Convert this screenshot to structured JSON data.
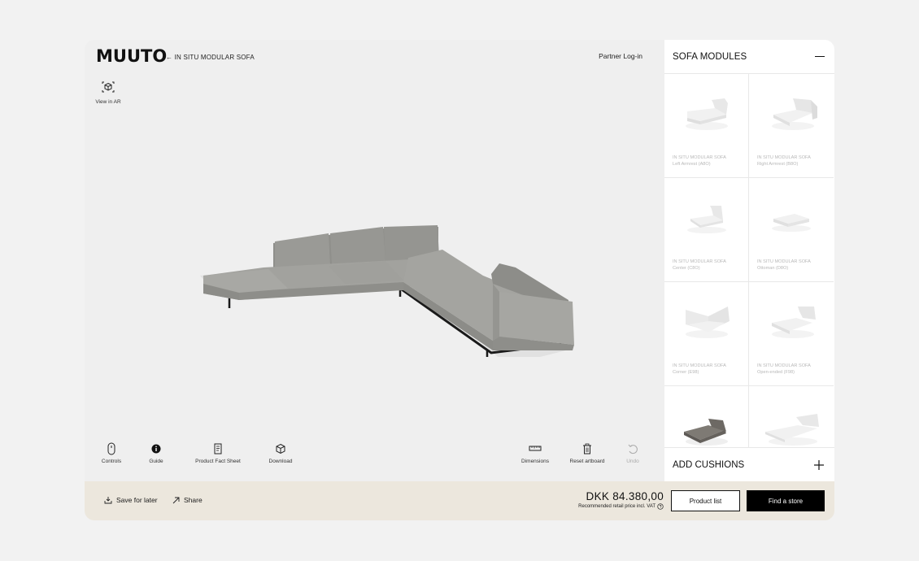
{
  "header": {
    "logo": "MUUTO",
    "back_label": "← IN SITU MODULAR SOFA",
    "partner_login": "Partner Log-in"
  },
  "ar": {
    "label": "View in AR"
  },
  "tools_left": [
    {
      "label": "Controls",
      "icon": "mouse-icon"
    },
    {
      "label": "Guide",
      "icon": "info-icon"
    },
    {
      "label": "Product Fact Sheet",
      "icon": "document-icon"
    },
    {
      "label": "Download",
      "icon": "cube-icon"
    }
  ],
  "tools_right": [
    {
      "label": "Dimensions",
      "icon": "ruler-icon"
    },
    {
      "label": "Reset artboard",
      "icon": "trash-icon"
    },
    {
      "label": "Undo",
      "icon": "undo-icon"
    }
  ],
  "sidebar": {
    "title": "SOFA MODULES",
    "collapse_symbol": "—",
    "modules": [
      {
        "name": "IN SITU MODULAR SOFA",
        "variant": "Left Armrest (A8O)"
      },
      {
        "name": "IN SITU MODULAR SOFA",
        "variant": "Right Armrest (B8O)"
      },
      {
        "name": "IN SITU MODULAR SOFA",
        "variant": "Center (C8O)"
      },
      {
        "name": "IN SITU MODULAR SOFA",
        "variant": "Ottoman (D8O)"
      },
      {
        "name": "IN SITU MODULAR SOFA",
        "variant": "Corner (E98)"
      },
      {
        "name": "IN SITU MODULAR SOFA",
        "variant": "Open-ended (F98)"
      }
    ],
    "footer_title": "ADD CUSHIONS",
    "footer_symbol": "+"
  },
  "bottom": {
    "save_label": "Save for later",
    "share_label": "Share",
    "price": "DKK 84.380,00",
    "price_note": "Recommended retail price incl. VAT",
    "product_list": "Product list",
    "find_store": "Find a store"
  },
  "colors": {
    "accent": "#000000",
    "bottom_bar": "#ece7dd",
    "viewer_bg": "#efefef"
  }
}
